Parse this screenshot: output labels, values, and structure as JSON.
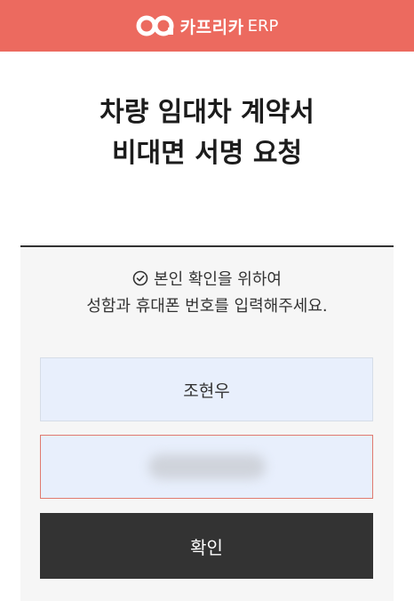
{
  "header": {
    "brand_name": "카프리카",
    "brand_suffix": "ERP",
    "logo_icon": "carprika-logo-icon",
    "bar_color": "#ec6a5f"
  },
  "page": {
    "title_line1": "차량 임대차 계약서",
    "title_line2": "비대면 서명 요청"
  },
  "verification": {
    "notice_line1": "본인 확인을 위하여",
    "notice_line2": "성함과 휴대폰 번호를 입력해주세요.",
    "notice_icon": "check-circle-icon",
    "name_value": "조현우",
    "confirm_label": "확인"
  }
}
